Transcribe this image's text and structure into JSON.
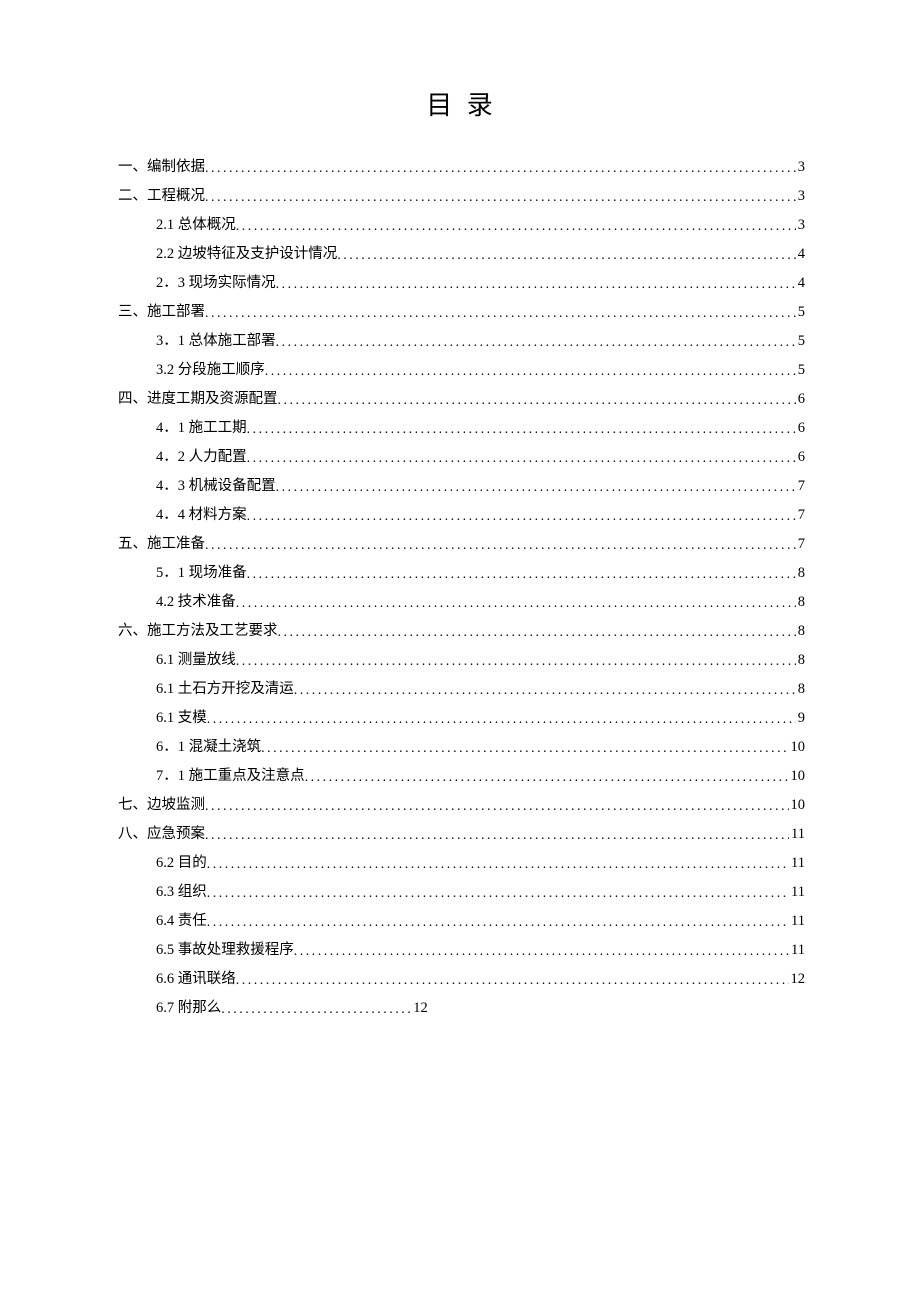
{
  "title": "目 录",
  "toc": [
    {
      "level": 1,
      "label": "一、编制依据",
      "page": "3"
    },
    {
      "level": 1,
      "label": "二、工程概况",
      "page": "3"
    },
    {
      "level": 2,
      "label": "2.1 总体概况",
      "page": "3"
    },
    {
      "level": 2,
      "label": "2.2 边坡特征及支护设计情况",
      "page": "4"
    },
    {
      "level": 2,
      "label": "2．3 现场实际情况",
      "page": "4"
    },
    {
      "level": 1,
      "label": "三、施工部署",
      "page": "5"
    },
    {
      "level": 2,
      "label": "3．1 总体施工部署",
      "page": "5"
    },
    {
      "level": 2,
      "label": "3.2 分段施工顺序",
      "page": "5"
    },
    {
      "level": 1,
      "label": "四、进度工期及资源配置",
      "page": "6"
    },
    {
      "level": 2,
      "label": "4．1 施工工期",
      "page": "6"
    },
    {
      "level": 2,
      "label": "4．2 人力配置",
      "page": "6"
    },
    {
      "level": 2,
      "label": "4．3 机械设备配置",
      "page": "7"
    },
    {
      "level": 2,
      "label": "4．4 材料方案",
      "page": "7"
    },
    {
      "level": 1,
      "label": "五、施工准备",
      "page": "7"
    },
    {
      "level": 2,
      "label": "5．1 现场准备",
      "page": "8"
    },
    {
      "level": 2,
      "label": "4.2 技术准备",
      "page": "8"
    },
    {
      "level": 1,
      "label": "六、施工方法及工艺要求",
      "page": "8"
    },
    {
      "level": 2,
      "label": "6.1 测量放线",
      "page": "8"
    },
    {
      "level": 2,
      "label": "6.1 土石方开挖及清运",
      "page": "8"
    },
    {
      "level": 2,
      "label": "6.1 支模",
      "page": "9"
    },
    {
      "level": 2,
      "label": "6．1 混凝土浇筑 ",
      "page": "10"
    },
    {
      "level": 2,
      "label": "7．1 施工重点及注意点 ",
      "page": "10"
    },
    {
      "level": 1,
      "label": "七、边坡监测",
      "page": "10"
    },
    {
      "level": 1,
      "label": "八、应急预案",
      "page": "11"
    },
    {
      "level": 2,
      "label": "6.2  目的 ",
      "page": "11"
    },
    {
      "level": 2,
      "label": "6.3  组织",
      "page": "11"
    },
    {
      "level": 2,
      "label": "6.4  责任",
      "page": "11"
    },
    {
      "level": 2,
      "label": "6.5  事故处理救援程序 ",
      "page": "11"
    },
    {
      "level": 2,
      "label": "6.6 通讯联络 ",
      "page": "12"
    },
    {
      "level": 2,
      "label": "6.7 附那么",
      "page": "12",
      "short": true
    }
  ]
}
